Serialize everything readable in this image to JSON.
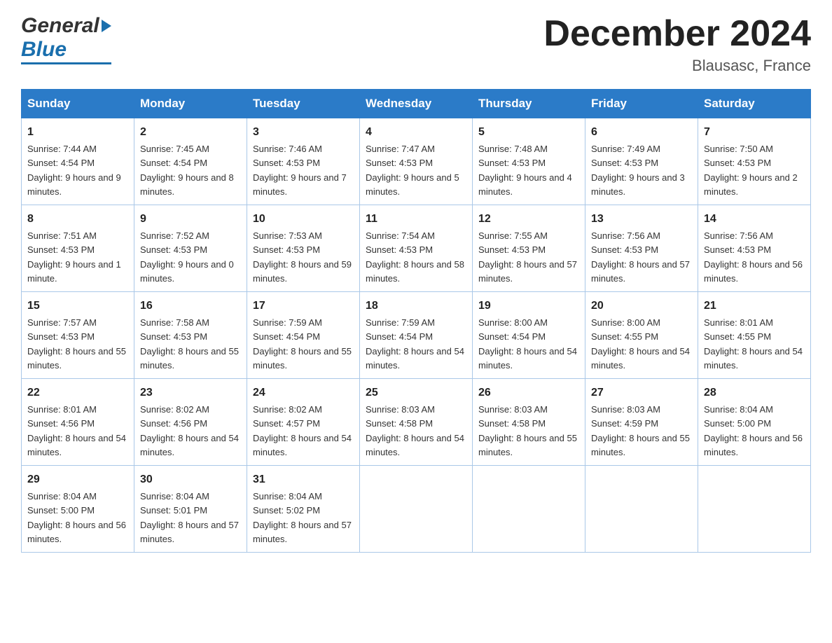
{
  "header": {
    "logo_general": "General",
    "logo_blue": "Blue",
    "main_title": "December 2024",
    "subtitle": "Blausasc, France"
  },
  "calendar": {
    "days_of_week": [
      "Sunday",
      "Monday",
      "Tuesday",
      "Wednesday",
      "Thursday",
      "Friday",
      "Saturday"
    ],
    "weeks": [
      [
        {
          "day": "1",
          "sunrise": "7:44 AM",
          "sunset": "4:54 PM",
          "daylight": "9 hours and 9 minutes."
        },
        {
          "day": "2",
          "sunrise": "7:45 AM",
          "sunset": "4:54 PM",
          "daylight": "9 hours and 8 minutes."
        },
        {
          "day": "3",
          "sunrise": "7:46 AM",
          "sunset": "4:53 PM",
          "daylight": "9 hours and 7 minutes."
        },
        {
          "day": "4",
          "sunrise": "7:47 AM",
          "sunset": "4:53 PM",
          "daylight": "9 hours and 5 minutes."
        },
        {
          "day": "5",
          "sunrise": "7:48 AM",
          "sunset": "4:53 PM",
          "daylight": "9 hours and 4 minutes."
        },
        {
          "day": "6",
          "sunrise": "7:49 AM",
          "sunset": "4:53 PM",
          "daylight": "9 hours and 3 minutes."
        },
        {
          "day": "7",
          "sunrise": "7:50 AM",
          "sunset": "4:53 PM",
          "daylight": "9 hours and 2 minutes."
        }
      ],
      [
        {
          "day": "8",
          "sunrise": "7:51 AM",
          "sunset": "4:53 PM",
          "daylight": "9 hours and 1 minute."
        },
        {
          "day": "9",
          "sunrise": "7:52 AM",
          "sunset": "4:53 PM",
          "daylight": "9 hours and 0 minutes."
        },
        {
          "day": "10",
          "sunrise": "7:53 AM",
          "sunset": "4:53 PM",
          "daylight": "8 hours and 59 minutes."
        },
        {
          "day": "11",
          "sunrise": "7:54 AM",
          "sunset": "4:53 PM",
          "daylight": "8 hours and 58 minutes."
        },
        {
          "day": "12",
          "sunrise": "7:55 AM",
          "sunset": "4:53 PM",
          "daylight": "8 hours and 57 minutes."
        },
        {
          "day": "13",
          "sunrise": "7:56 AM",
          "sunset": "4:53 PM",
          "daylight": "8 hours and 57 minutes."
        },
        {
          "day": "14",
          "sunrise": "7:56 AM",
          "sunset": "4:53 PM",
          "daylight": "8 hours and 56 minutes."
        }
      ],
      [
        {
          "day": "15",
          "sunrise": "7:57 AM",
          "sunset": "4:53 PM",
          "daylight": "8 hours and 55 minutes."
        },
        {
          "day": "16",
          "sunrise": "7:58 AM",
          "sunset": "4:53 PM",
          "daylight": "8 hours and 55 minutes."
        },
        {
          "day": "17",
          "sunrise": "7:59 AM",
          "sunset": "4:54 PM",
          "daylight": "8 hours and 55 minutes."
        },
        {
          "day": "18",
          "sunrise": "7:59 AM",
          "sunset": "4:54 PM",
          "daylight": "8 hours and 54 minutes."
        },
        {
          "day": "19",
          "sunrise": "8:00 AM",
          "sunset": "4:54 PM",
          "daylight": "8 hours and 54 minutes."
        },
        {
          "day": "20",
          "sunrise": "8:00 AM",
          "sunset": "4:55 PM",
          "daylight": "8 hours and 54 minutes."
        },
        {
          "day": "21",
          "sunrise": "8:01 AM",
          "sunset": "4:55 PM",
          "daylight": "8 hours and 54 minutes."
        }
      ],
      [
        {
          "day": "22",
          "sunrise": "8:01 AM",
          "sunset": "4:56 PM",
          "daylight": "8 hours and 54 minutes."
        },
        {
          "day": "23",
          "sunrise": "8:02 AM",
          "sunset": "4:56 PM",
          "daylight": "8 hours and 54 minutes."
        },
        {
          "day": "24",
          "sunrise": "8:02 AM",
          "sunset": "4:57 PM",
          "daylight": "8 hours and 54 minutes."
        },
        {
          "day": "25",
          "sunrise": "8:03 AM",
          "sunset": "4:58 PM",
          "daylight": "8 hours and 54 minutes."
        },
        {
          "day": "26",
          "sunrise": "8:03 AM",
          "sunset": "4:58 PM",
          "daylight": "8 hours and 55 minutes."
        },
        {
          "day": "27",
          "sunrise": "8:03 AM",
          "sunset": "4:59 PM",
          "daylight": "8 hours and 55 minutes."
        },
        {
          "day": "28",
          "sunrise": "8:04 AM",
          "sunset": "5:00 PM",
          "daylight": "8 hours and 56 minutes."
        }
      ],
      [
        {
          "day": "29",
          "sunrise": "8:04 AM",
          "sunset": "5:00 PM",
          "daylight": "8 hours and 56 minutes."
        },
        {
          "day": "30",
          "sunrise": "8:04 AM",
          "sunset": "5:01 PM",
          "daylight": "8 hours and 57 minutes."
        },
        {
          "day": "31",
          "sunrise": "8:04 AM",
          "sunset": "5:02 PM",
          "daylight": "8 hours and 57 minutes."
        },
        null,
        null,
        null,
        null
      ]
    ]
  }
}
